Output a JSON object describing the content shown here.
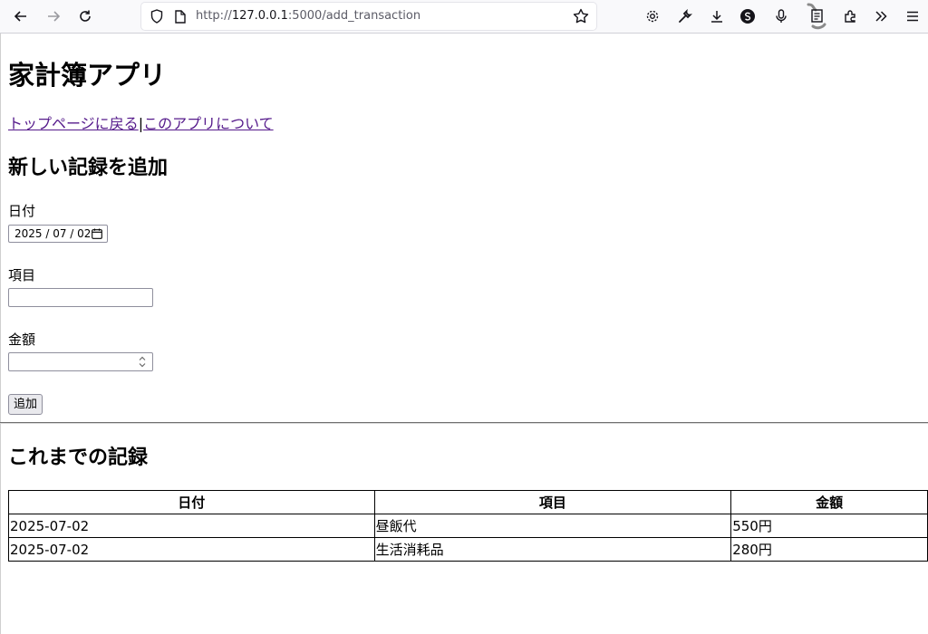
{
  "browser": {
    "url_prefix": "http://",
    "url_host": "127.0.0.1",
    "url_rest": ":5000/add_transaction"
  },
  "page": {
    "title": "家計簿アプリ",
    "nav": {
      "home_link": "トップページに戻る",
      "separator": "|",
      "about_link": "このアプリについて"
    },
    "form": {
      "heading": "新しい記録を追加",
      "date_label": "日付",
      "date_value": "2025 / 07 / 02",
      "item_label": "項目",
      "item_value": "",
      "amount_label": "金額",
      "amount_value": "",
      "submit_label": "追加"
    },
    "records": {
      "heading": "これまでの記録",
      "columns": [
        "日付",
        "項目",
        "金額"
      ],
      "rows": [
        [
          "2025-07-02",
          "昼飯代",
          "550円"
        ],
        [
          "2025-07-02",
          "生活消耗品",
          "280円"
        ]
      ]
    }
  }
}
